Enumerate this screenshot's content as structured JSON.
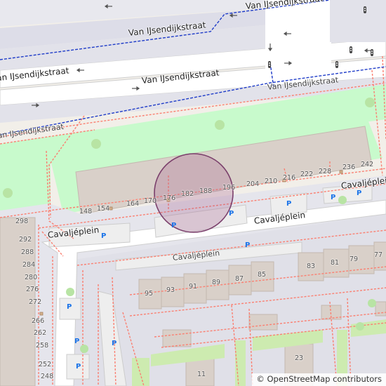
{
  "map": {
    "streets": {
      "van_ijsendijkstraat_top": "Van IJsendijkstraat",
      "van_ijsendijkstraat_lane1": "Van IJsendijkstraat",
      "van_ijsendijkstraat_lane2": "Van IJsendijkstraat",
      "van_ijsendijkstraat_right": "Van IJsendijkstraat",
      "van_ijsendijkstraat_path": "Van IJsendijkstraat",
      "van_ijsendijkstraat_edge_top": "Van IJsendijkstraat",
      "cavaljeplein_main": "Cavaljéplein",
      "cavaljeplein_left": "Cavaljéplein",
      "cavaljeplein_right": "Cavaljéplein",
      "cavaljeplein_lower": "Cavaljéplein"
    },
    "house_numbers_building": [
      "148",
      "154",
      "164",
      "170",
      "176",
      "182",
      "188",
      "196",
      "204",
      "210",
      "216",
      "222",
      "228",
      "236",
      "242"
    ],
    "house_numbers_left": [
      "298",
      "292",
      "288",
      "284",
      "280",
      "276",
      "272",
      "266",
      "262",
      "258",
      "252",
      "248"
    ],
    "house_numbers_lower": [
      "95",
      "93",
      "91",
      "89",
      "87",
      "85",
      "83",
      "81",
      "79",
      "77",
      "23",
      "11"
    ],
    "parking_symbol": "P",
    "marker": {
      "color": "#a45c8c",
      "label": ""
    },
    "colors": {
      "background": "#f2efe9",
      "park": "#c8facc",
      "building": "#d9d0c9",
      "road": "#ffffff",
      "pedestrian": "#dddde8",
      "parking": "#eeeeee",
      "footway": "#fa8072",
      "boundary": "#1f3cc8"
    }
  },
  "attribution": {
    "symbol": "©",
    "text": "OpenStreetMap contributors"
  }
}
